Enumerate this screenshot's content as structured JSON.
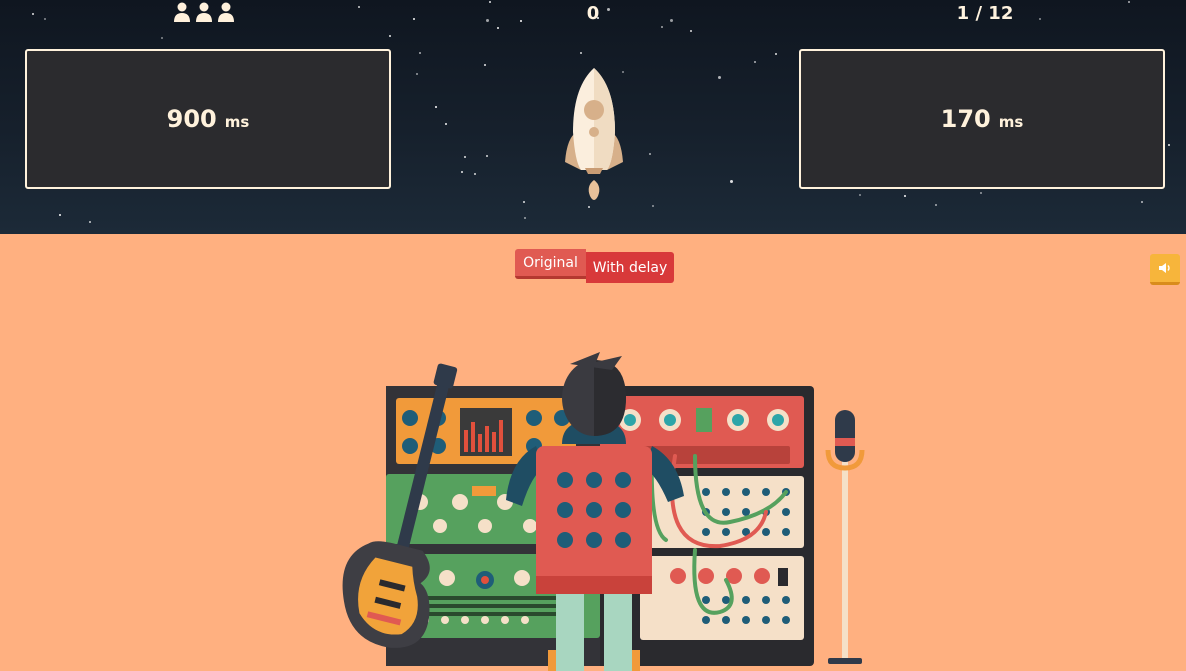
{
  "hud": {
    "lives_icon": "person-icon",
    "lives_count": 3,
    "score": "0",
    "level": "1 / 12"
  },
  "panels": {
    "left": {
      "value": "900",
      "unit": "ms"
    },
    "right": {
      "value": "170",
      "unit": "ms"
    }
  },
  "tabs": {
    "original_label": "Original",
    "delay_label": "With delay",
    "active": "original"
  },
  "sound_button": {
    "icon": "speaker-icon"
  },
  "colors": {
    "sky": "#16202c",
    "ground": "#ffb080",
    "panel_bg": "#2b2b2e",
    "panel_border": "#fff2dc",
    "tab_active": "#e05a52",
    "tab_inactive": "#d8393a",
    "sound_button": "#f7b53b"
  }
}
